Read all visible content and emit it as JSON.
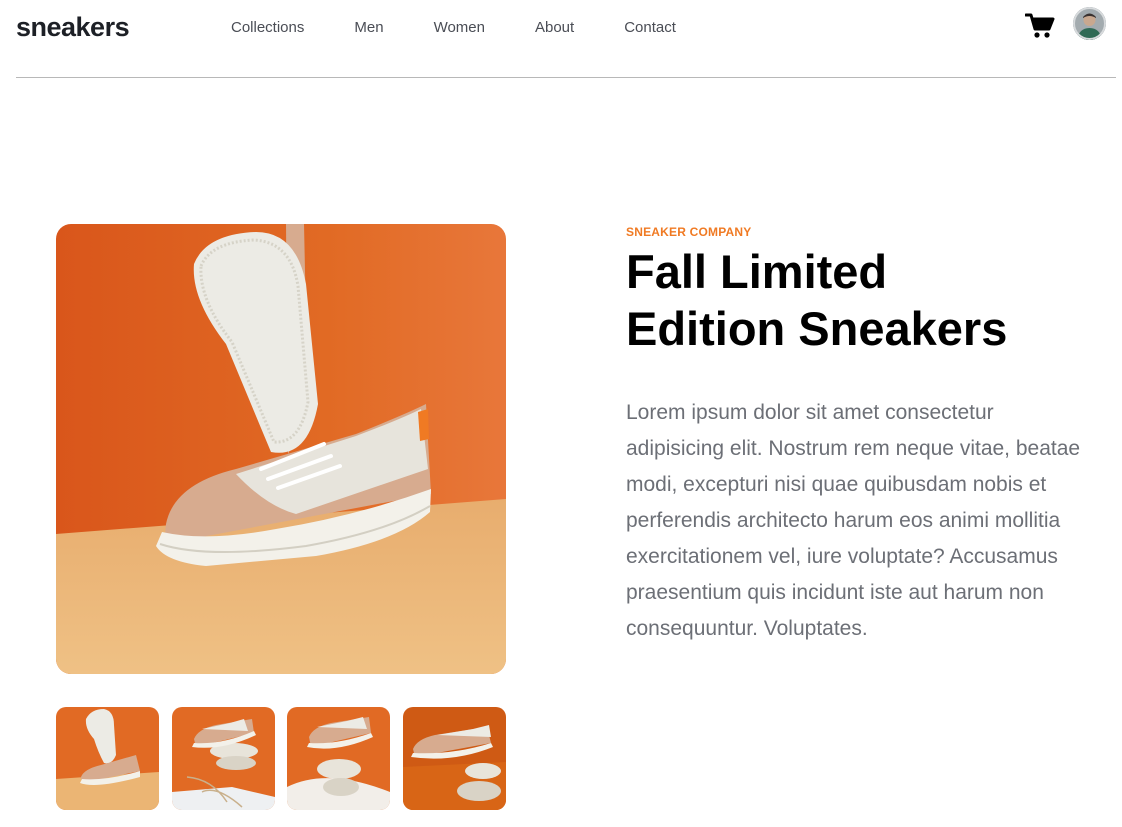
{
  "header": {
    "logo": "sneakers",
    "nav": [
      "Collections",
      "Men",
      "Women",
      "About",
      "Contact"
    ],
    "cart_icon": "cart-icon",
    "avatar_icon": "avatar"
  },
  "product": {
    "company": "SNEAKER COMPANY",
    "title_line1": "Fall Limited",
    "title_line2": "Edition Sneakers",
    "description": "Lorem ipsum dolor sit amet consectetur adipisicing elit. Nostrum rem neque vitae, beatae modi, excepturi nisi quae quibusdam nobis et perferendis architecto harum eos animi mollitia exercitationem vel, iure voluptate? Accusamus praesentium quis incidunt iste aut harum non consequuntur. Voluptates."
  },
  "colors": {
    "accent": "#f07a23",
    "background_orange": "#e0671f",
    "floor_beige": "#eab777",
    "text_dark": "#000000",
    "text_muted": "#6c6f76"
  },
  "gallery": {
    "main_image": "sneaker-product-photo",
    "thumbnails": [
      "thumbnail-1",
      "thumbnail-2",
      "thumbnail-3",
      "thumbnail-4"
    ]
  }
}
